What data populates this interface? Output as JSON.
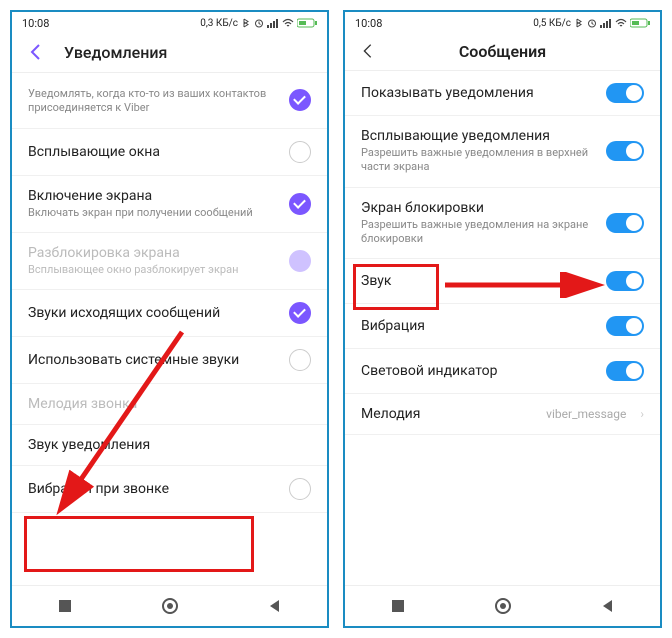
{
  "left": {
    "status": {
      "time": "10:08",
      "net": "0,3 КБ/с"
    },
    "header": "Уведомления",
    "rows": [
      {
        "label": "",
        "sub": "Уведомлять, когда кто-то из ваших контактов присоединяется к Viber",
        "checked": true
      },
      {
        "label": "Всплывающие окна",
        "sub": "",
        "checked": false
      },
      {
        "label": "Включение экрана",
        "sub": "Включать экран при получении сообщений",
        "checked": true
      },
      {
        "label": "Разблокировка экрана",
        "sub": "Всплывающее окно разблокирует экран",
        "checked": "dim",
        "disabled": true
      },
      {
        "label": "Звуки исходящих сообщений",
        "sub": "",
        "checked": true
      },
      {
        "label": "Использовать системные звуки",
        "sub": "",
        "checked": false
      },
      {
        "label": "Мелодия звонка",
        "sub": "",
        "disabled": true
      },
      {
        "label": "Звук уведомления",
        "sub": ""
      },
      {
        "label": "Вибрация при звонке",
        "sub": "",
        "checked": false
      }
    ]
  },
  "right": {
    "status": {
      "time": "10:08",
      "net": "0,5 КБ/с"
    },
    "header": "Сообщения",
    "rows": [
      {
        "label": "Показывать уведомления",
        "sub": "",
        "toggle": true
      },
      {
        "label": "Всплывающие уведомления",
        "sub": "Разрешить важные уведомления в верхней части экрана",
        "toggle": true
      },
      {
        "label": "Экран блокировки",
        "sub": "Разрешить важные уведомления на экране блокировки",
        "toggle": true
      },
      {
        "label": "Звук",
        "sub": "",
        "toggle": true
      },
      {
        "label": "Вибрация",
        "sub": "",
        "toggle": true
      },
      {
        "label": "Световой индикатор",
        "sub": "",
        "toggle": true
      },
      {
        "label": "Мелодия",
        "value": "viber_message"
      }
    ]
  }
}
